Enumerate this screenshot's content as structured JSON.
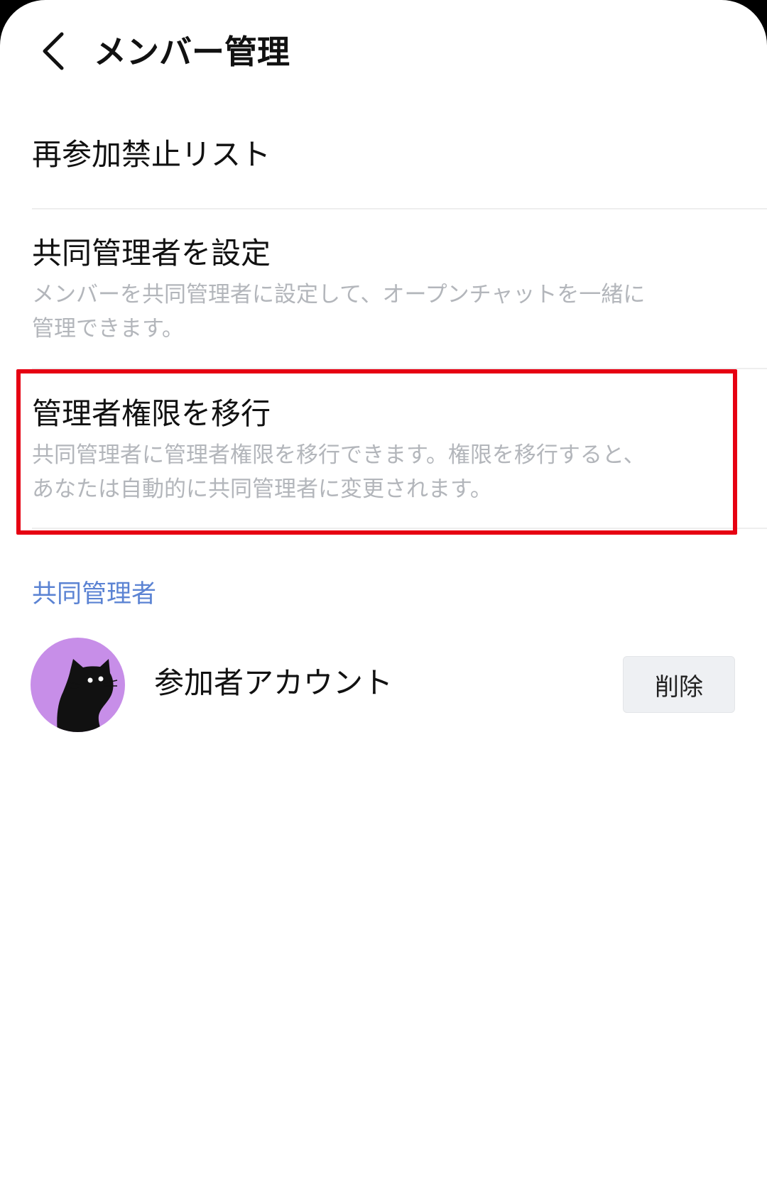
{
  "header": {
    "title": "メンバー管理",
    "back_icon": "chevron-left-icon"
  },
  "menu": {
    "items": [
      {
        "title": "再参加禁止リスト"
      },
      {
        "title": "共同管理者を設定",
        "description_lines": [
          "メンバーを共同管理者に設定して、オープンチャットを一緒に",
          "管理できます。"
        ]
      },
      {
        "title": "管理者権限を移行",
        "description_lines": [
          "共同管理者に管理者権限を移行できます。権限を移行すると、",
          "あなたは自動的に共同管理者に変更されます。"
        ]
      }
    ]
  },
  "co_admins": {
    "section_label": "共同管理者",
    "members": [
      {
        "name": "参加者アカウント",
        "delete_label": "削除",
        "avatar": "black-cat-avatar"
      }
    ]
  },
  "colors": {
    "highlight": "#e60012",
    "section_label": "#5b83d3",
    "description": "#b3b6bb",
    "avatar_bg": "#c78ee8"
  }
}
